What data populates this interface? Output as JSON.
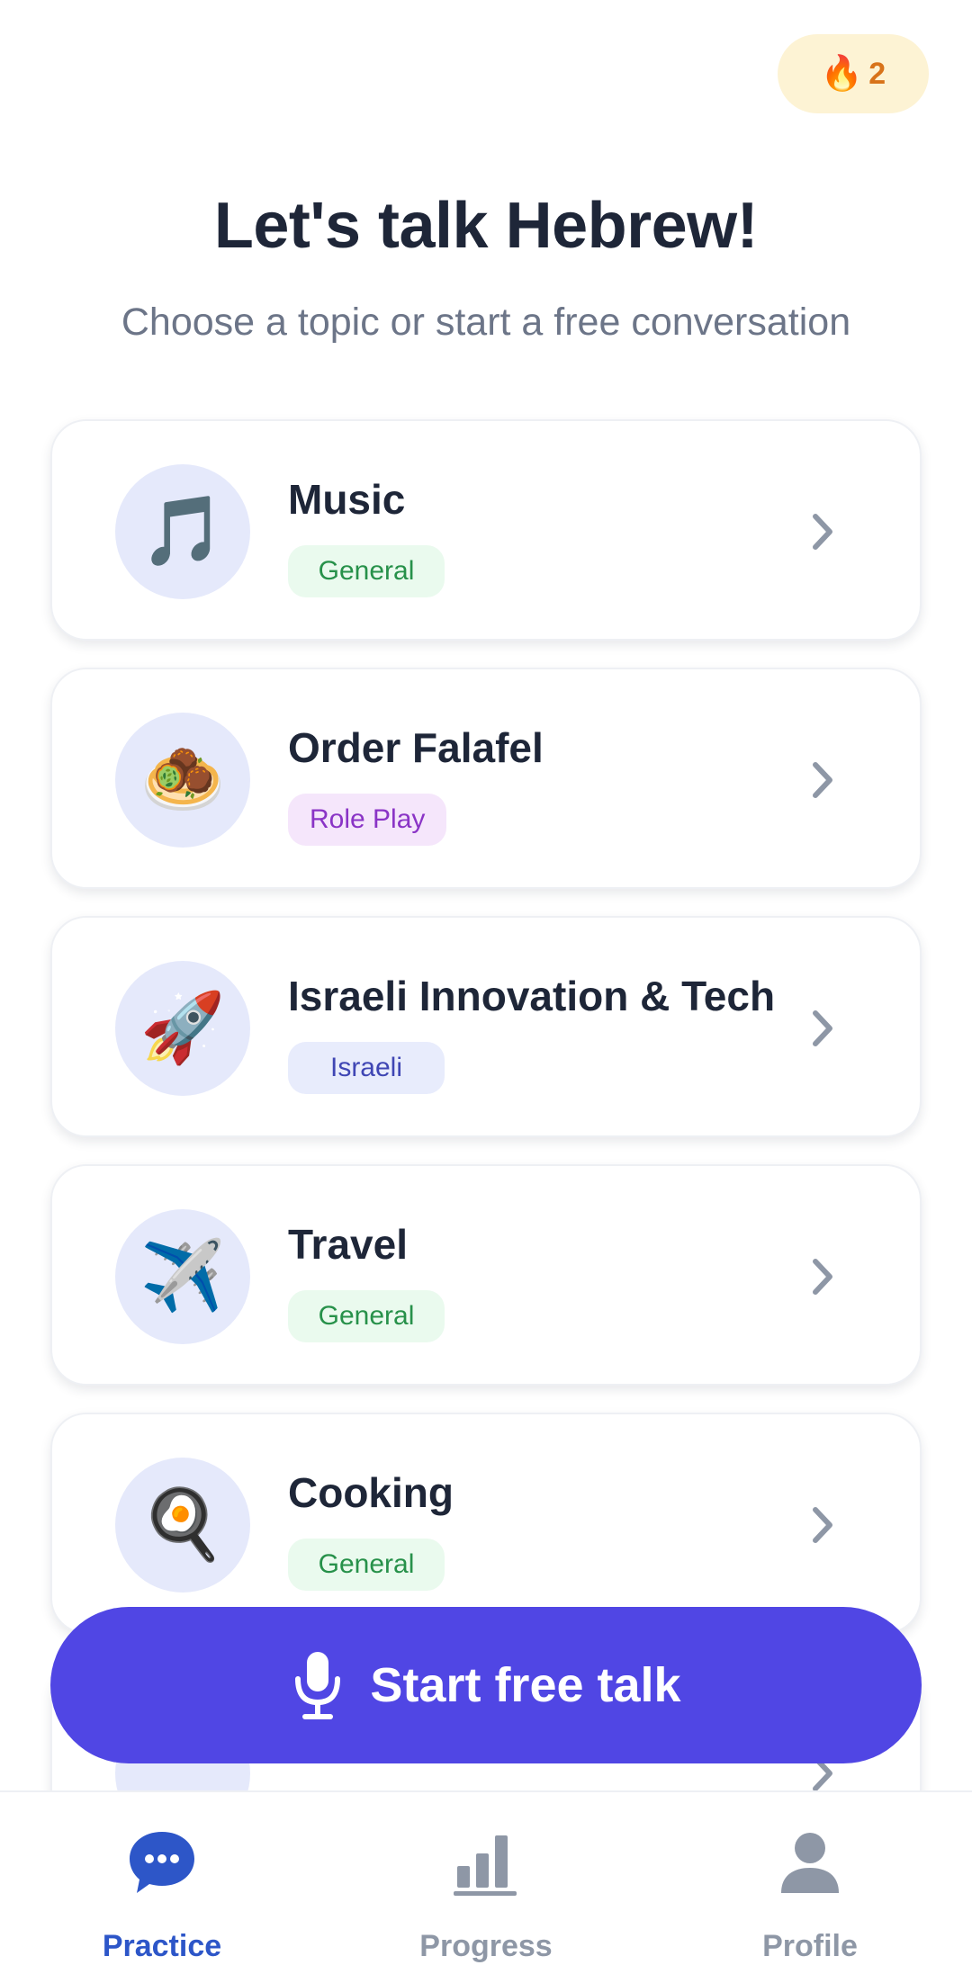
{
  "streak": {
    "icon": "flame-icon",
    "count": "2"
  },
  "header": {
    "title": "Let's talk Hebrew!",
    "subtitle": "Choose a topic or start a free conversation"
  },
  "topics": [
    {
      "name": "Music",
      "tag": "General",
      "icon": "music-notes-icon"
    },
    {
      "name": "Order Falafel",
      "tag": "Role Play",
      "icon": "falafel-icon"
    },
    {
      "name": "Israeli Innovation & Tech",
      "tag": "Israeli",
      "icon": "rocket-icon"
    },
    {
      "name": "Travel",
      "tag": "General",
      "icon": "airplane-icon"
    },
    {
      "name": "Cooking",
      "tag": "General",
      "icon": "frying-pan-icon"
    }
  ],
  "cta": {
    "label": "Start free talk",
    "icon": "microphone-icon"
  },
  "tabs": [
    {
      "label": "Practice",
      "icon": "chat-bubble-icon",
      "active": true
    },
    {
      "label": "Progress",
      "icon": "bar-chart-icon",
      "active": false
    },
    {
      "label": "Profile",
      "icon": "person-icon",
      "active": false
    }
  ],
  "colors": {
    "accent": "#5046E4",
    "active_tab": "#2D56C8",
    "inactive_tab": "#8E97A6",
    "tag_general": "#27914A",
    "tag_roleplay": "#8A34C6",
    "tag_israeli": "#3F46B4"
  }
}
